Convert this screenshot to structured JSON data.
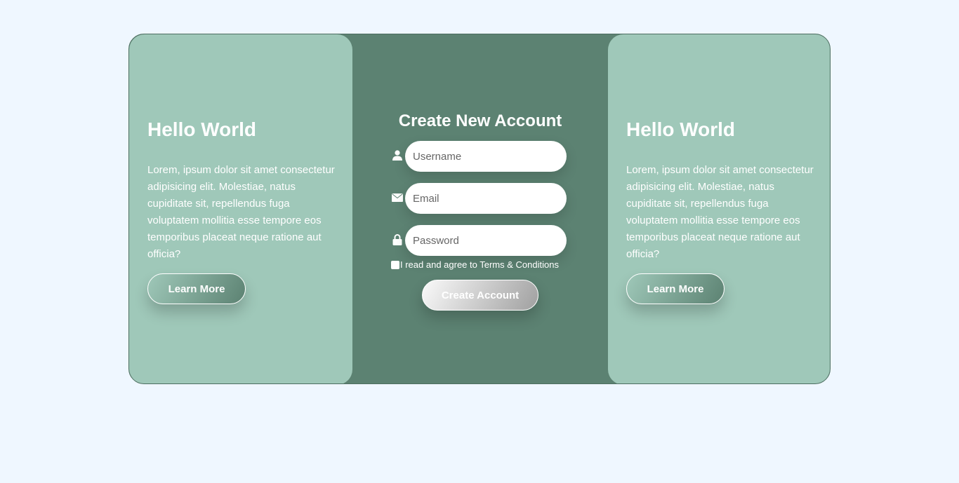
{
  "left_panel": {
    "title": "Hello World",
    "body": "Lorem, ipsum dolor sit amet consectetur adipisicing elit. Molestiae, natus cupiditate sit, repellendus fuga voluptatem mollitia esse tempore eos temporibus placeat neque ratione aut officia?",
    "button": "Learn More"
  },
  "right_panel": {
    "title": "Hello World",
    "body": "Lorem, ipsum dolor sit amet consectetur adipisicing elit. Molestiae, natus cupiditate sit, repellendus fuga voluptatem mollitia esse tempore eos temporibus placeat neque ratione aut officia?",
    "button": "Learn More"
  },
  "form": {
    "title": "Create New Account",
    "username_placeholder": "Username",
    "email_placeholder": "Email",
    "password_placeholder": "Password",
    "terms": "I read and agree to Terms & Conditions",
    "submit": "Create Account",
    "icons": {
      "user": "user-icon",
      "email": "envelope-icon",
      "password": "lock-icon"
    }
  },
  "colors": {
    "background": "#eff7ff",
    "card": "#5c8272",
    "panel": "#9fc8b9"
  }
}
